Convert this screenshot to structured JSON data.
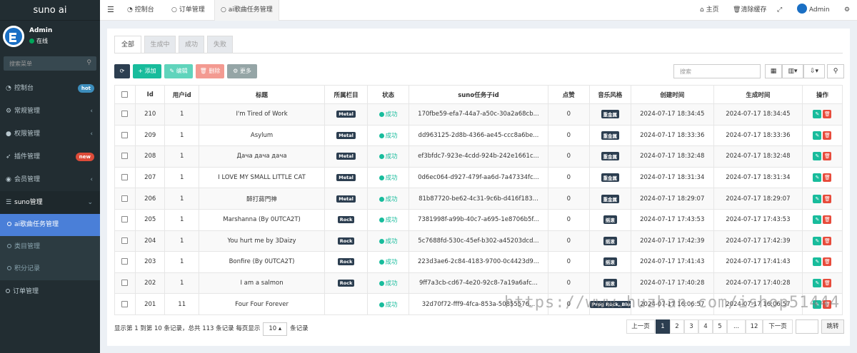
{
  "brand": "suno ai",
  "user": {
    "name": "Admin",
    "status": "在线"
  },
  "sidebar_search_placeholder": "搜索菜单",
  "menu": [
    {
      "icon": "dashboard-icon",
      "label": "控制台",
      "badge": "hot"
    },
    {
      "icon": "cogs-icon",
      "label": "常规管理",
      "arrow": "‹"
    },
    {
      "icon": "group-icon",
      "label": "权限管理",
      "arrow": "‹"
    },
    {
      "icon": "rocket-icon",
      "label": "插件管理",
      "badge": "new"
    },
    {
      "icon": "user-circle-icon",
      "label": "会员管理",
      "arrow": "‹"
    },
    {
      "icon": "list-icon",
      "label": "suno管理",
      "arrow": "⌄"
    }
  ],
  "submenu": [
    {
      "label": "ai歌曲任务管理"
    },
    {
      "label": "类目管理"
    },
    {
      "label": "积分记录"
    }
  ],
  "menu_after": {
    "label": "订单管理"
  },
  "navtabs": [
    {
      "label": "控制台"
    },
    {
      "label": "订单管理"
    },
    {
      "label": "ai歌曲任务管理"
    }
  ],
  "topright": {
    "home": "主页",
    "clear_cache": "清除缓存",
    "admin": "Admin"
  },
  "status_tabs": [
    "全部",
    "生成中",
    "成功",
    "失败"
  ],
  "toolbar": {
    "add": "添加",
    "edit": "编辑",
    "delete": "删除",
    "more": "更多",
    "search_placeholder": "搜索"
  },
  "columns": [
    "Id",
    "用户id",
    "标题",
    "所属栏目",
    "状态",
    "suno任务子id",
    "点赞",
    "音乐风格",
    "创建时间",
    "生成时间",
    "操作"
  ],
  "rows": [
    {
      "id": "210",
      "uid": "1",
      "title": "I'm Tired of Work",
      "category": "Metal",
      "status": "成功",
      "task": "170fbe59-efa7-44a7-a50c-30a2a68cb...",
      "likes": "0",
      "style": "重金属",
      "created": "2024-07-17 18:34:45",
      "generated": "2024-07-17 18:34:45"
    },
    {
      "id": "209",
      "uid": "1",
      "title": "Asylum",
      "category": "Metal",
      "status": "成功",
      "task": "dd963125-2d8b-4366-ae45-ccc8a6be...",
      "likes": "0",
      "style": "重金属",
      "created": "2024-07-17 18:33:36",
      "generated": "2024-07-17 18:33:36"
    },
    {
      "id": "208",
      "uid": "1",
      "title": "Дача дача дача",
      "category": "Metal",
      "status": "成功",
      "task": "ef3bfdc7-923e-4cdd-924b-242e1661c...",
      "likes": "0",
      "style": "重金属",
      "created": "2024-07-17 18:32:48",
      "generated": "2024-07-17 18:32:48"
    },
    {
      "id": "207",
      "uid": "1",
      "title": "I LOVE MY SMALL LITTLE CAT",
      "category": "Metal",
      "status": "成功",
      "task": "0d6ec064-d927-479f-aa6d-7a47334fc...",
      "likes": "0",
      "style": "重金属",
      "created": "2024-07-17 18:31:34",
      "generated": "2024-07-17 18:31:34"
    },
    {
      "id": "206",
      "uid": "1",
      "title": "醉打蔣門神",
      "category": "Metal",
      "status": "成功",
      "task": "81b87720-be62-4c31-9c6b-d416f183...",
      "likes": "0",
      "style": "重金属",
      "created": "2024-07-17 18:29:07",
      "generated": "2024-07-17 18:29:07"
    },
    {
      "id": "205",
      "uid": "1",
      "title": "Marshanna (By 0UTCA2T)",
      "category": "Rock",
      "status": "成功",
      "task": "7381998f-a99b-40c7-a695-1e8706b5f...",
      "likes": "0",
      "style": "摇滚",
      "created": "2024-07-17 17:43:53",
      "generated": "2024-07-17 17:43:53"
    },
    {
      "id": "204",
      "uid": "1",
      "title": "You hurt me by 3Daizy",
      "category": "Rock",
      "status": "成功",
      "task": "5c7688fd-530c-45ef-b302-a45203dcd...",
      "likes": "0",
      "style": "摇滚",
      "created": "2024-07-17 17:42:39",
      "generated": "2024-07-17 17:42:39"
    },
    {
      "id": "203",
      "uid": "1",
      "title": "Bonfire (By 0UTCA2T)",
      "category": "Rock",
      "status": "成功",
      "task": "223d3ae6-2c84-4183-9700-0c4423d9...",
      "likes": "0",
      "style": "摇滚",
      "created": "2024-07-17 17:41:43",
      "generated": "2024-07-17 17:41:43"
    },
    {
      "id": "202",
      "uid": "1",
      "title": "I am a salmon",
      "category": "Rock",
      "status": "成功",
      "task": "9ff7a3cb-cd67-4e20-92c8-7a19a6afc...",
      "likes": "0",
      "style": "摇滚",
      "created": "2024-07-17 17:40:28",
      "generated": "2024-07-17 17:40:28"
    },
    {
      "id": "201",
      "uid": "11",
      "title": "Four Four Forever",
      "category": "",
      "status": "成功",
      "task": "32d70f72-fff9-4fca-853a-50855576...",
      "likes": "0",
      "style": "Prog Rock, Blues",
      "created": "2024-07-17 16:06:57",
      "generated": "2024-07-17 16:06:57"
    }
  ],
  "footer": {
    "info": "显示第 1 到第 10 条记录，总共 113 条记录 每页显示",
    "page_size": "10 ▴",
    "suffix": "条记录"
  },
  "pager": {
    "prev": "上一页",
    "pages": [
      "1",
      "2",
      "3",
      "4",
      "5",
      "...",
      "12"
    ],
    "next": "下一页",
    "jump": "跳转"
  },
  "watermark": "https://www.huzhan.com/ishop51444"
}
